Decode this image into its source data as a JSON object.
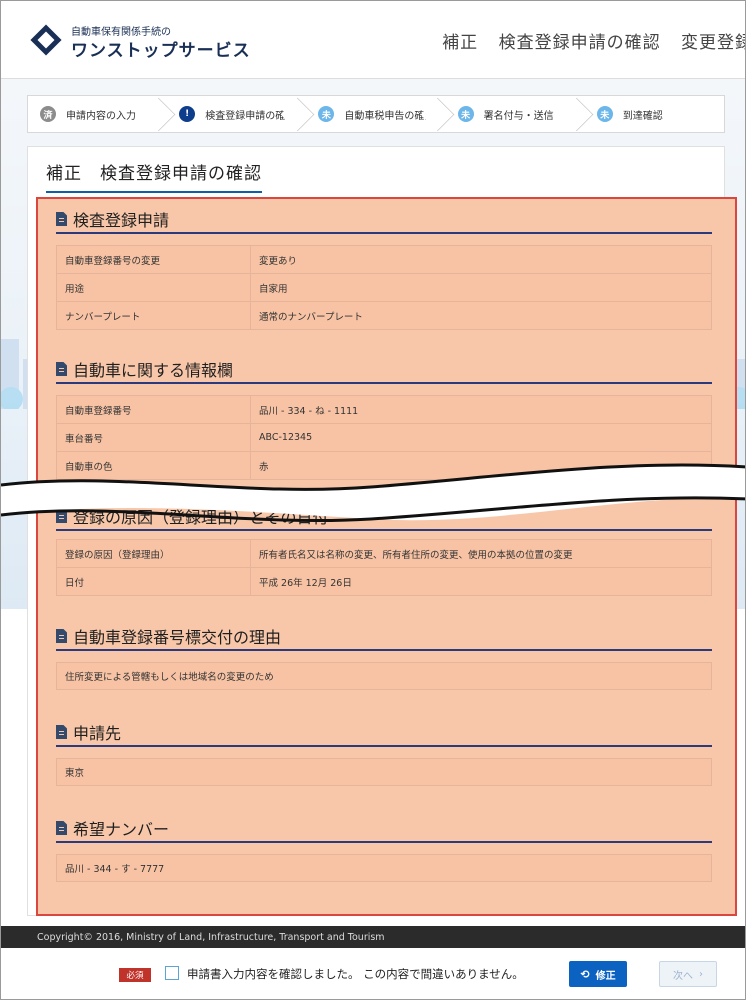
{
  "header": {
    "logo_sub": "自動車保有関係手続の",
    "logo_main": "ワンストップサービス",
    "page_title_parts": [
      "補正",
      "検査登録申請の確認",
      "変更登録"
    ]
  },
  "steps": [
    {
      "badge": "済",
      "label": "申請内容の入力",
      "state": "done"
    },
    {
      "badge": "!",
      "label": "検査登録申請の確認",
      "state": "current"
    },
    {
      "badge": "未",
      "label": "自動車税申告の確認",
      "state": "todo"
    },
    {
      "badge": "未",
      "label": "署名付与・送信",
      "state": "todo"
    },
    {
      "badge": "未",
      "label": "到達確認",
      "state": "todo"
    }
  ],
  "main": {
    "title": "補正　検査登録申請の確認"
  },
  "sections": {
    "s1": {
      "title": "検査登録申請",
      "rows": [
        {
          "k": "自動車登録番号の変更",
          "v": "変更あり"
        },
        {
          "k": "用途",
          "v": "自家用"
        },
        {
          "k": "ナンバープレート",
          "v": "通常のナンバープレート"
        }
      ]
    },
    "s2": {
      "title": "自動車に関する情報欄",
      "rows": [
        {
          "k": "自動車登録番号",
          "v": "品川 - 334 - ね - 1111"
        },
        {
          "k": "車台番号",
          "v": "ABC-12345"
        },
        {
          "k": "自動車の色",
          "v": "赤"
        }
      ]
    },
    "s3": {
      "title": "登録の原因（登録理由）とその日付",
      "rows": [
        {
          "k": "登録の原因（登録理由）",
          "v": "所有者氏名又は名称の変更、所有者住所の変更、使用の本拠の位置の変更"
        },
        {
          "k": "日付",
          "v": "平成 26年 12月 26日"
        }
      ]
    },
    "s4": {
      "title": "自動車登録番号標交付の理由",
      "value": "住所変更による管轄もしくは地域名の変更のため"
    },
    "s5": {
      "title": "申請先",
      "value": "東京"
    },
    "s6": {
      "title": "希望ナンバー",
      "value": "品川 - 344 - す - 7777"
    }
  },
  "footer": {
    "copyright": "Copyright© 2016, Ministry of Land, Infrastructure, Transport and Tourism",
    "required": "必須",
    "confirm_label": "申請書入力内容を確認しました。 この内容で間違いありません。",
    "fix_button": "修正",
    "next_button": "次へ"
  },
  "colors": {
    "highlight": "#f8c7a9",
    "highlight_border": "#d9473e",
    "primary": "#0b62c1",
    "brand": "#1a2f55"
  }
}
